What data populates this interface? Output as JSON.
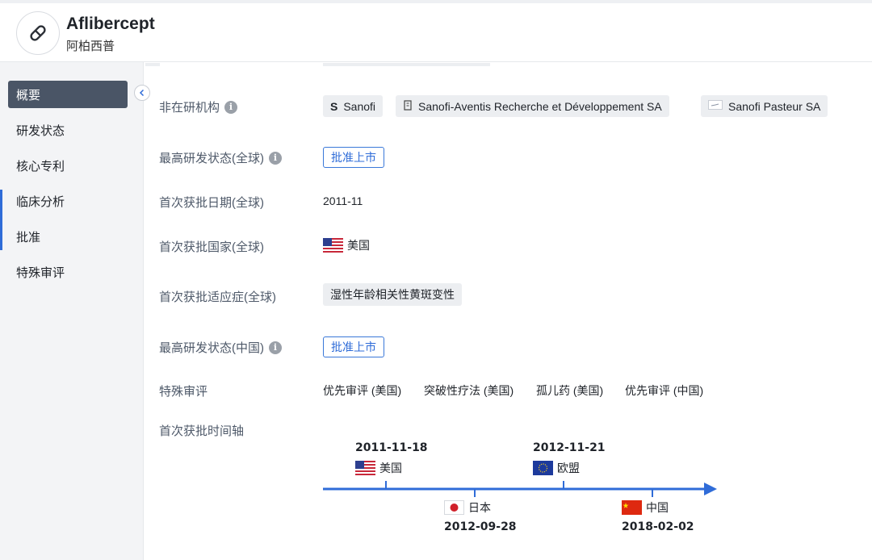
{
  "header": {
    "drug_name": "Aflibercept",
    "drug_cn_name": "阿柏西普",
    "icon": "pill-icon"
  },
  "sidebar": {
    "items": [
      {
        "label": "概要",
        "active": true
      },
      {
        "label": "研发状态",
        "active": false
      },
      {
        "label": "核心专利",
        "active": false
      },
      {
        "label": "临床分析",
        "active": false
      },
      {
        "label": "批准",
        "active": false
      },
      {
        "label": "特殊审评",
        "active": false
      }
    ],
    "collapse_icon": "chevron-left-icon"
  },
  "details": {
    "inactive_orgs": {
      "label": "非在研机构",
      "orgs": [
        {
          "name": "Sanofi",
          "icon": "sanofi-logo"
        },
        {
          "name": "Sanofi-Aventis Recherche et Développement SA",
          "icon": "building-icon"
        },
        {
          "name": "Sanofi Pasteur SA",
          "icon": "sanofi-pasteur-logo"
        }
      ]
    },
    "highest_status_global": {
      "label": "最高研发状态(全球)",
      "value": "批准上市"
    },
    "first_approval_date_global": {
      "label": "首次获批日期(全球)",
      "value": "2011-11"
    },
    "first_approval_country_global": {
      "label": "首次获批国家(全球)",
      "value": "美国",
      "flag": "us-flag"
    },
    "first_approval_indication_global": {
      "label": "首次获批适应症(全球)",
      "value": "湿性年龄相关性黄斑变性"
    },
    "highest_status_china": {
      "label": "最高研发状态(中国)",
      "value": "批准上市"
    },
    "special_review": {
      "label": "特殊审评",
      "items": [
        "优先审评 (美国)",
        "突破性疗法 (美国)",
        "孤儿药 (美国)",
        "优先审评 (中国)"
      ]
    },
    "timeline": {
      "label": "首次获批时间轴",
      "events": [
        {
          "date": "2011-11-18",
          "country": "美国",
          "flag": "us-flag"
        },
        {
          "date": "2012-09-28",
          "country": "日本",
          "flag": "jp-flag"
        },
        {
          "date": "2012-11-21",
          "country": "欧盟",
          "flag": "eu-flag"
        },
        {
          "date": "2018-02-02",
          "country": "中国",
          "flag": "cn-flag"
        }
      ],
      "axis_color": "#2f6cd8"
    }
  },
  "colors": {
    "accent": "#2f6cd8",
    "sidebar_active_bg": "#4a5566",
    "sidebar_bg": "#f3f4f6"
  }
}
